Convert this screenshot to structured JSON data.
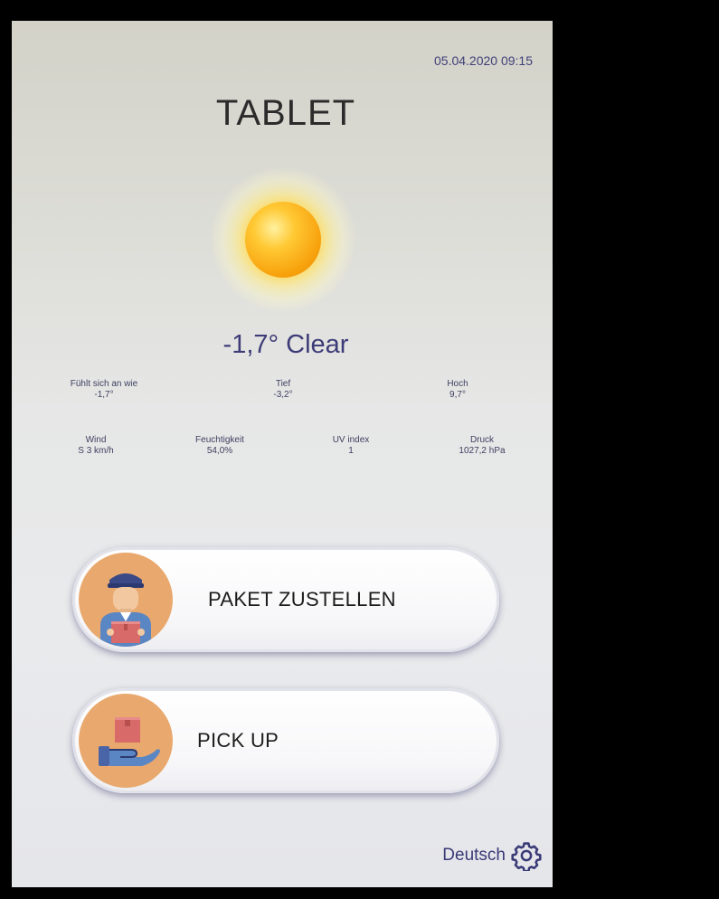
{
  "status": {
    "datetime": "05.04.2020 09:15"
  },
  "header": {
    "title": "TABLET"
  },
  "weather": {
    "icon": "sun-icon",
    "summary": "-1,7° Clear",
    "row1": [
      {
        "label": "Fühlt sich an wie",
        "value": "-1,7°"
      },
      {
        "label": "Tief",
        "value": "-3,2°"
      },
      {
        "label": "Hoch",
        "value": "9,7°"
      }
    ],
    "row2": [
      {
        "label": "Wind",
        "value": "S 3 km/h"
      },
      {
        "label": "Feuchtigkeit",
        "value": "54,0%"
      },
      {
        "label": "UV index",
        "value": "1"
      },
      {
        "label": "Druck",
        "value": "1027,2 hPa"
      }
    ]
  },
  "actions": {
    "deliver_label": "PAKET ZUSTELLEN",
    "deliver_icon": "courier-with-package-icon",
    "pickup_label": "PICK UP",
    "pickup_icon": "hand-holding-package-icon"
  },
  "footer": {
    "language": "Deutsch",
    "settings_icon": "gear-icon"
  },
  "colors": {
    "accent_text": "#3e3c78",
    "avatar_bg": "#e9a86d",
    "sun": "#f7a10c"
  }
}
